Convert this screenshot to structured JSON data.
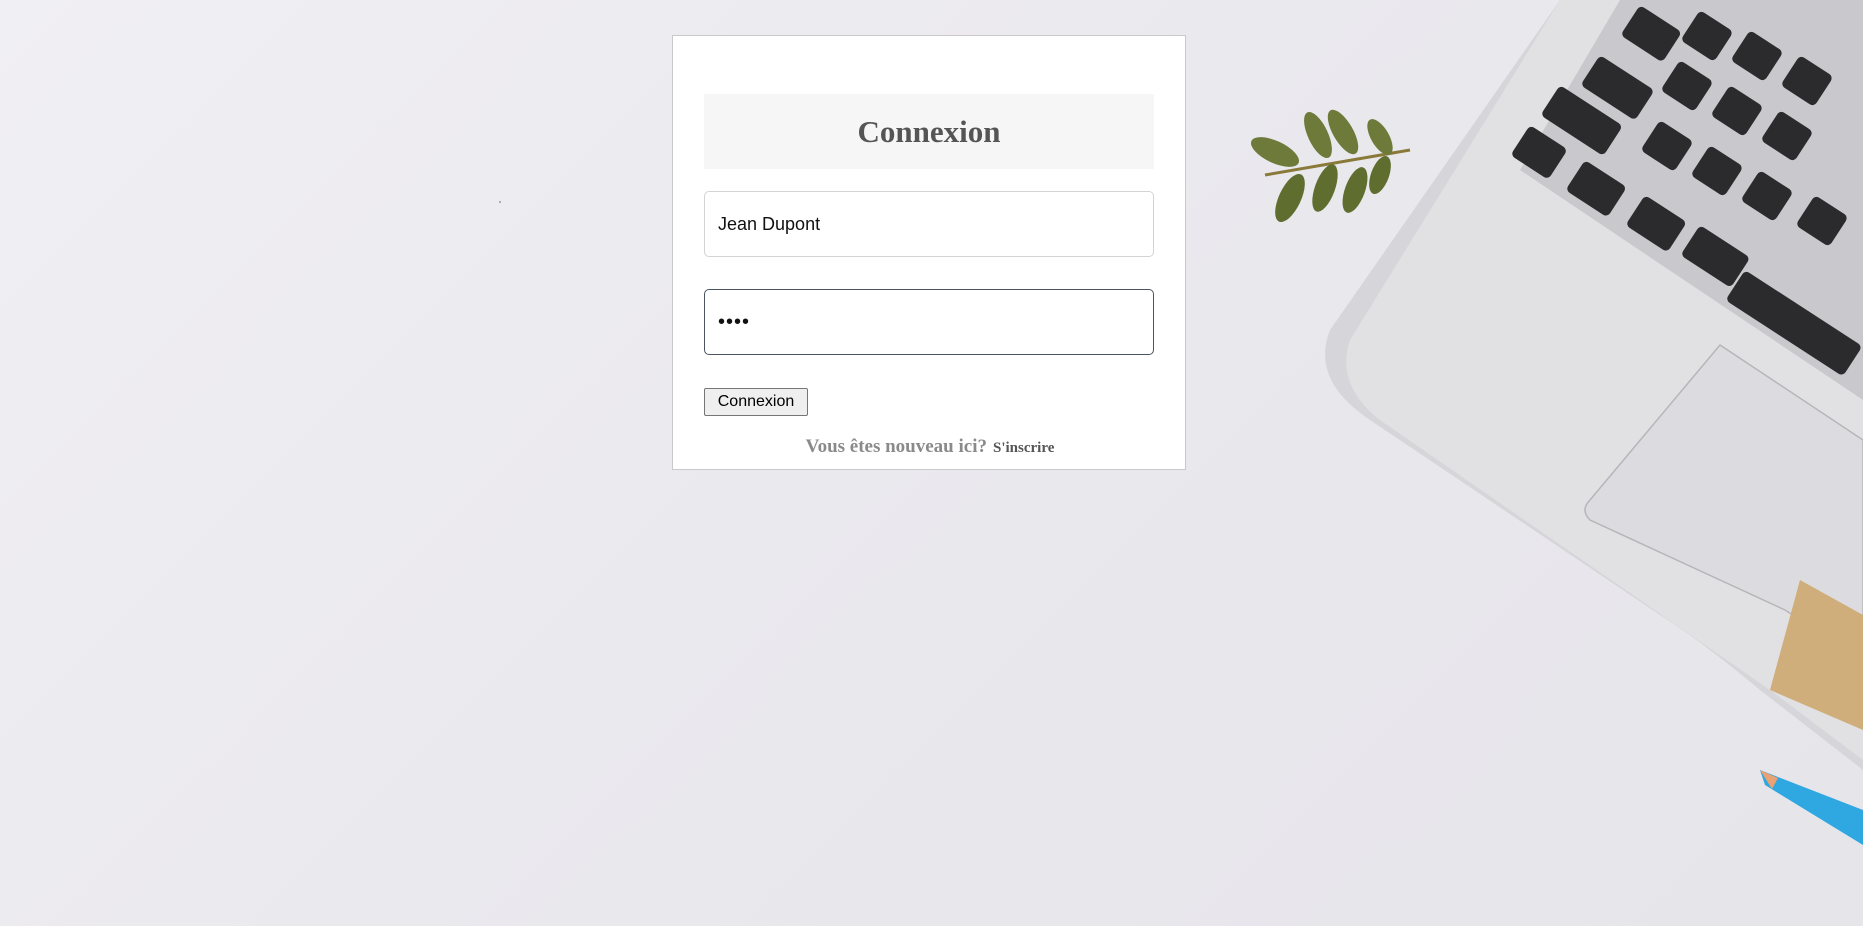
{
  "login": {
    "title": "Connexion",
    "username_value": "Jean Dupont",
    "password_value": "••••",
    "submit_label": "Connexion",
    "signup_question": "Vous êtes nouveau ici?",
    "signup_link": "S'inscrire"
  },
  "colors": {
    "background": "#ecebef",
    "card": "#ffffff",
    "title_band": "#f6f6f6",
    "leaf": "#6d7a3a",
    "laptop": "#d9d9dd",
    "keys": "#2b2b2e",
    "pencil": "#2fa7e0"
  },
  "decor": {
    "left": "leaf-sprig-icon",
    "right": "laptop-icon",
    "bottom_right": "pencil-icon"
  }
}
